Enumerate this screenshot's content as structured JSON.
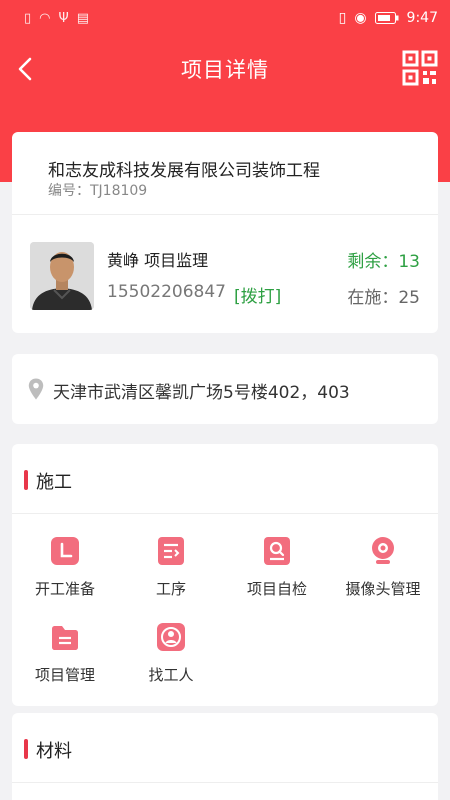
{
  "status_bar": {
    "time": "9:47",
    "left_icons": [
      "alert-icon",
      "wifi-icon",
      "usb-icon",
      "calendar-icon"
    ],
    "right_icons": [
      "vibrate-icon",
      "eye-icon",
      "battery-icon"
    ]
  },
  "header": {
    "title": "项目详情"
  },
  "project": {
    "name": "和志友成科技发展有限公司装饰工程",
    "code": "编号：TJ18109",
    "person": "黄峥 项目监理",
    "phone": "15502206847",
    "dial_label": "[拨打]",
    "remaining": "剩余：13",
    "in_progress": "在施：25"
  },
  "address": "天津市武清区馨凯广场5号楼402，403",
  "construction": {
    "title": "施工",
    "items": [
      {
        "label": "开工准备",
        "icon": "start-prep-icon"
      },
      {
        "label": "工序",
        "icon": "process-icon"
      },
      {
        "label": "项目自检",
        "icon": "self-check-icon"
      },
      {
        "label": "摄像头管理",
        "icon": "camera-icon"
      },
      {
        "label": "项目管理",
        "icon": "folder-icon"
      },
      {
        "label": "找工人",
        "icon": "find-worker-icon"
      }
    ]
  },
  "materials": {
    "title": "材料"
  },
  "colors": {
    "primary_red": "#fa4046",
    "icon_pink": "#f26d7e",
    "green": "#2ea043",
    "accent_bar": "#e8374a"
  }
}
